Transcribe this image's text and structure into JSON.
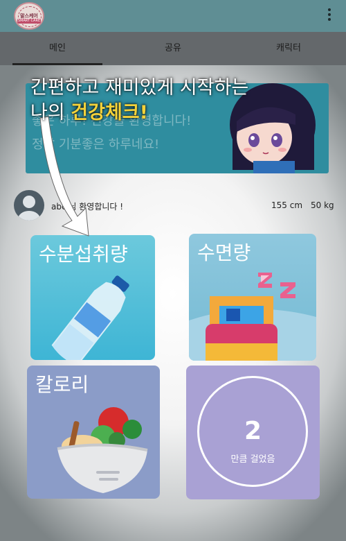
{
  "app": {
    "logo_text": "말스케어",
    "logo_banner": "SMART CARE"
  },
  "tabs": [
    {
      "label": "메인",
      "active": true
    },
    {
      "label": "공유",
      "active": false
    },
    {
      "label": "캐릭터",
      "active": false
    }
  ],
  "banner": {
    "line1": "좋은 하루! 건강을 환영합니다!",
    "line2": "정말 기분좋은 하루네요!"
  },
  "profile": {
    "welcome": "abc 님 환영합니다 !",
    "height": "155 cm",
    "weight": "50 kg"
  },
  "tiles": {
    "water": {
      "title": "수분섭취량",
      "icon": "water-bottle-icon"
    },
    "sleep": {
      "title": "수면량",
      "icon": "bed-icon"
    },
    "calorie": {
      "title": "칼로리",
      "icon": "salad-bowl-icon"
    },
    "steps": {
      "value": "2",
      "label": "만큼 걸었음"
    }
  },
  "tutorial": {
    "line1": "간편하고 재미있게 시작하는",
    "line2_prefix": "나의 ",
    "line2_highlight": "건강체크!"
  },
  "colors": {
    "topbar": "#5f8e94",
    "banner": "#2f8d9f",
    "water_tile": "#3eb5d5",
    "sleep_tile": "#74bad3",
    "calorie_tile": "#8b9cc8",
    "steps_tile": "#a9a1d4",
    "highlight": "#f4d23a"
  }
}
